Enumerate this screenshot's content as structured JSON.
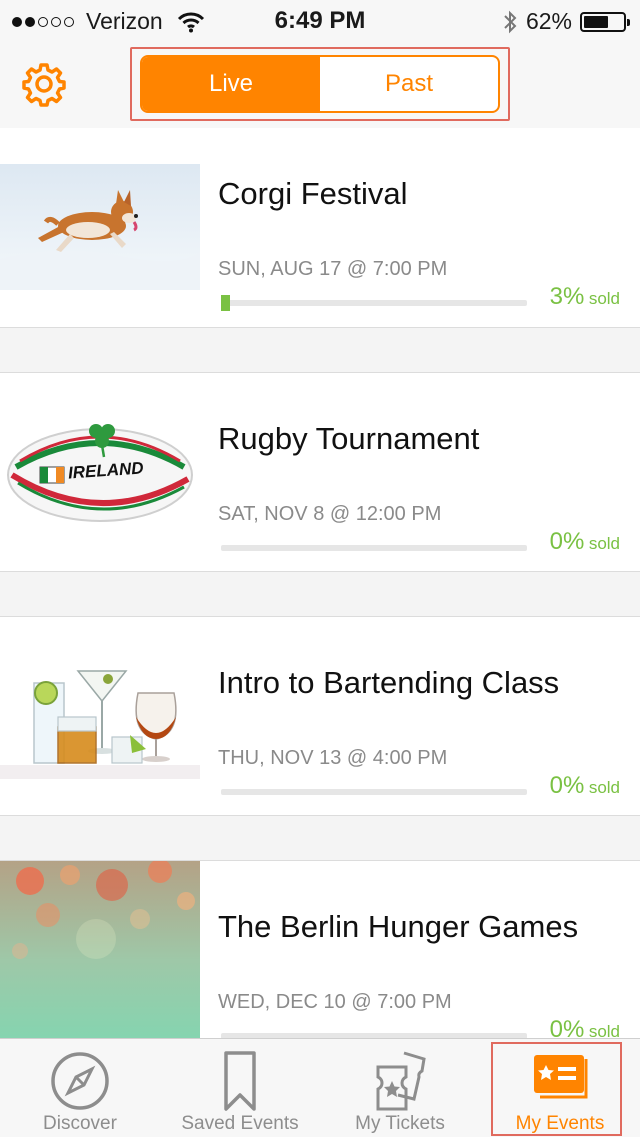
{
  "status_bar": {
    "carrier": "Verizon",
    "time": "6:49 PM",
    "battery": "62%",
    "battery_level": 0.62,
    "signal_bars": 2
  },
  "header": {
    "segments": [
      {
        "label": "Live",
        "active": true
      },
      {
        "label": "Past",
        "active": false
      }
    ]
  },
  "events": [
    {
      "title": "Corgi Festival",
      "date": "SUN, AUG 17 @ 7:00 PM",
      "sold_pct": "3%",
      "sold_suffix": "sold",
      "sold_fraction": 0.03
    },
    {
      "title": "Rugby Tournament",
      "date": "SAT, NOV 8 @ 12:00 PM",
      "sold_pct": "0%",
      "sold_suffix": "sold",
      "sold_fraction": 0.0,
      "ball_text": "IRELAND"
    },
    {
      "title": "Intro to Bartending Class",
      "date": "THU, NOV 13 @ 4:00 PM",
      "sold_pct": "0%",
      "sold_suffix": "sold",
      "sold_fraction": 0.0
    },
    {
      "title": "The Berlin Hunger Games",
      "date": "WED, DEC 10 @ 7:00 PM",
      "sold_pct": "0%",
      "sold_suffix": "sold",
      "sold_fraction": 0.0
    }
  ],
  "tabbar": {
    "tabs": [
      {
        "label": "Discover",
        "icon": "compass-icon",
        "active": false
      },
      {
        "label": "Saved Events",
        "icon": "bookmark-icon",
        "active": false
      },
      {
        "label": "My Tickets",
        "icon": "tickets-icon",
        "active": false
      },
      {
        "label": "My Events",
        "icon": "event-card-icon",
        "active": true
      }
    ]
  },
  "colors": {
    "accent": "#ff8400",
    "sold_green": "#7ac143",
    "highlight_outline": "#e06a5e"
  }
}
